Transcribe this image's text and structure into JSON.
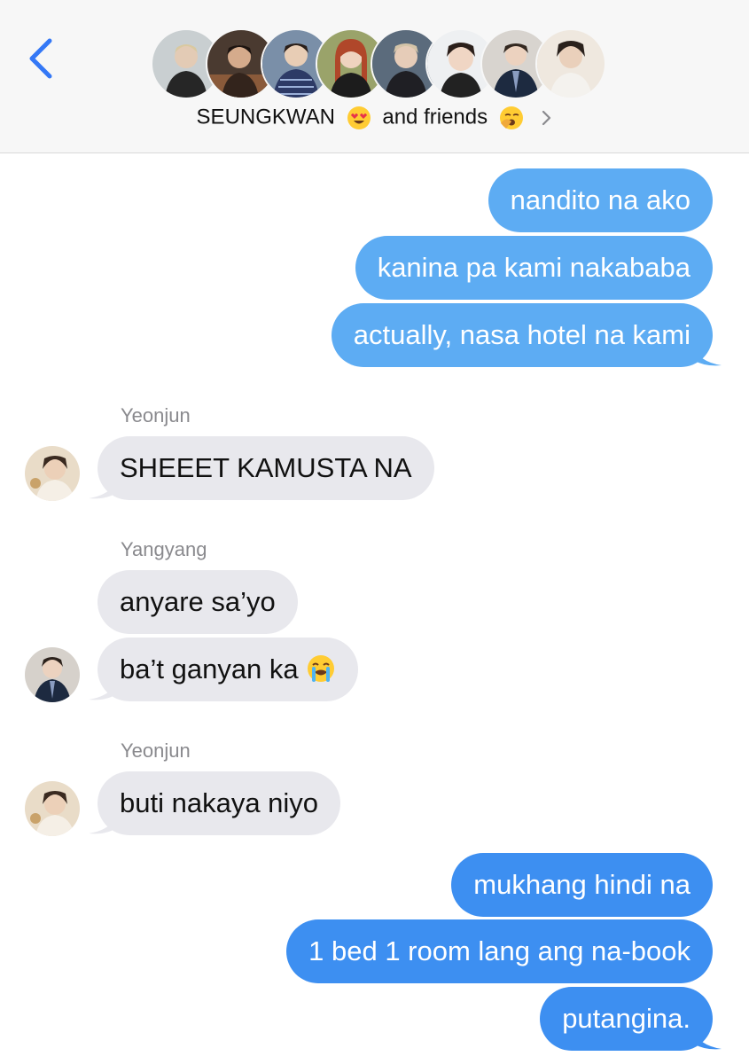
{
  "header": {
    "title_name": "SEUNGKWAN",
    "title_rest": "and friends",
    "title_emoji_1": "heart-eyes-emoji",
    "title_emoji_2": "yawning-face-emoji",
    "accent_color": "#3478f6",
    "avatars": [
      {
        "name": "member-1"
      },
      {
        "name": "member-2"
      },
      {
        "name": "member-3"
      },
      {
        "name": "member-4"
      },
      {
        "name": "member-5"
      },
      {
        "name": "member-6"
      },
      {
        "name": "member-7"
      },
      {
        "name": "member-8"
      }
    ]
  },
  "messages": [
    {
      "direction": "outgoing",
      "text": "nandito na ako"
    },
    {
      "direction": "outgoing",
      "text": "kanina pa kami nakababa"
    },
    {
      "direction": "outgoing",
      "text": "actually, nasa hotel na kami"
    },
    {
      "direction": "incoming",
      "sender": "Yeonjun",
      "text": "SHEEET KAMUSTA NA"
    },
    {
      "direction": "incoming",
      "sender": "Yangyang",
      "text": "anyare sa’yo"
    },
    {
      "direction": "incoming",
      "text": "ba’t ganyan ka",
      "emoji": "loudly-crying-emoji"
    },
    {
      "direction": "incoming",
      "sender": "Yeonjun",
      "text": "buti nakaya niyo"
    },
    {
      "direction": "outgoing",
      "text": "mukhang hindi na"
    },
    {
      "direction": "outgoing",
      "text": "1 bed 1 room lang ang na-book"
    },
    {
      "direction": "outgoing",
      "text": "putangina."
    }
  ],
  "colors": {
    "outgoing_bubble": "#5dacf3",
    "outgoing_bubble_dark": "#3d8ff1",
    "incoming_bubble": "#e8e8ed",
    "sender_label": "#8a8a8e"
  }
}
